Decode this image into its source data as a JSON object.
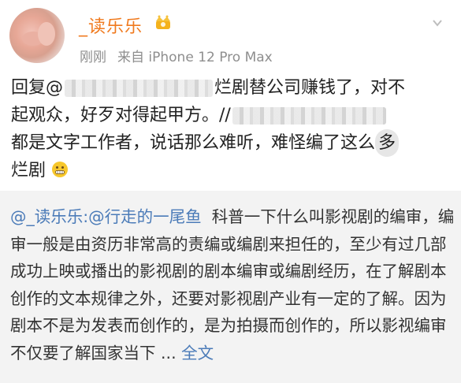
{
  "post": {
    "author": "_读乐乐",
    "time": "刚刚",
    "source": "来自 iPhone 12 Pro Max",
    "text_reply_prefix": "回复@",
    "text_line1_rest": "烂剧替公司赚钱了，对不",
    "text_line2": "起观众，好歹对得起甲方。//",
    "text_line3_a": "都是文字工作者，说话那么难听，难怪编了这么",
    "text_line3_b": "多",
    "text_line4": "烂剧"
  },
  "quote": {
    "user1": "@_读乐乐",
    "user2": ":@行走的一尾鱼",
    "body": "科普一下什么叫影视剧的编审，编审一般是由资历非常高的责编或编剧来担任的，至少有过几部成功上映或播出的影视剧的剧本编审或编剧经历，在了解剧本创作的文本规律之外，还要对影视剧产业有一定的了解。因为剧本不是为发表而创作的，是为拍摄而创作的，所以影视编审不仅要了解国家当下",
    "ellipsis": "...",
    "more": "全文"
  },
  "colors": {
    "author": "#f07a1e",
    "link": "#4b7bb8",
    "meta": "#8e8e8e",
    "quote_bg": "#f3f3f3"
  },
  "icons": [
    "crown-badge-icon",
    "chevron-down-icon",
    "grimace-emoji-icon"
  ]
}
